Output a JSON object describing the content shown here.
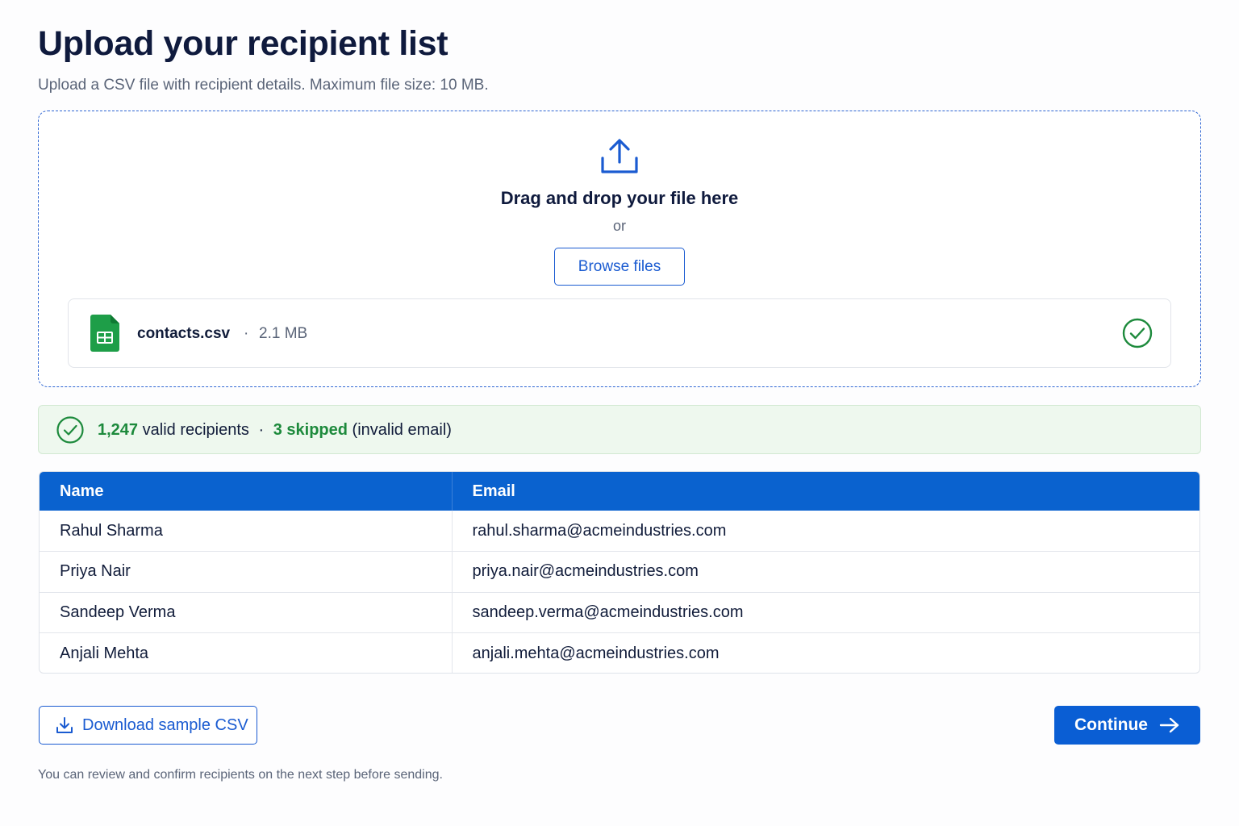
{
  "header": {
    "title": "Upload your recipient list",
    "subtitle": "Upload a CSV file with recipient details. Maximum file size: 10 MB."
  },
  "dropzone": {
    "icon": "upload-icon",
    "title": "Drag and drop your file here",
    "or_text": "or",
    "browse_label": "Browse files"
  },
  "file": {
    "icon": "spreadsheet-file-icon",
    "name": "contacts.csv",
    "separator": "·",
    "size": "2.1 MB",
    "status_icon": "check-circle-icon"
  },
  "summary": {
    "valid_count": "1,247",
    "valid_label": "valid recipients",
    "separator": "·",
    "skipped_label": "3 skipped",
    "skipped_reason": "(invalid email)"
  },
  "table": {
    "columns": [
      "Name",
      "Email"
    ],
    "rows": [
      [
        "Rahul Sharma",
        "rahul.sharma@acmeindustries.com"
      ],
      [
        "Priya Nair",
        "priya.nair@acmeindustries.com"
      ],
      [
        "Sandeep Verma",
        "sandeep.verma@acmeindustries.com"
      ],
      [
        "Anjali Mehta",
        "anjali.mehta@acmeindustries.com"
      ]
    ]
  },
  "actions": {
    "download_label": "Download sample CSV",
    "continue_label": "Continue"
  },
  "footer": {
    "note": "You can review and confirm recipients on the next step before sending."
  },
  "colors": {
    "accent": "#0a5ed4",
    "success": "#1d8a3c",
    "header_bg": "#0a62cf"
  }
}
